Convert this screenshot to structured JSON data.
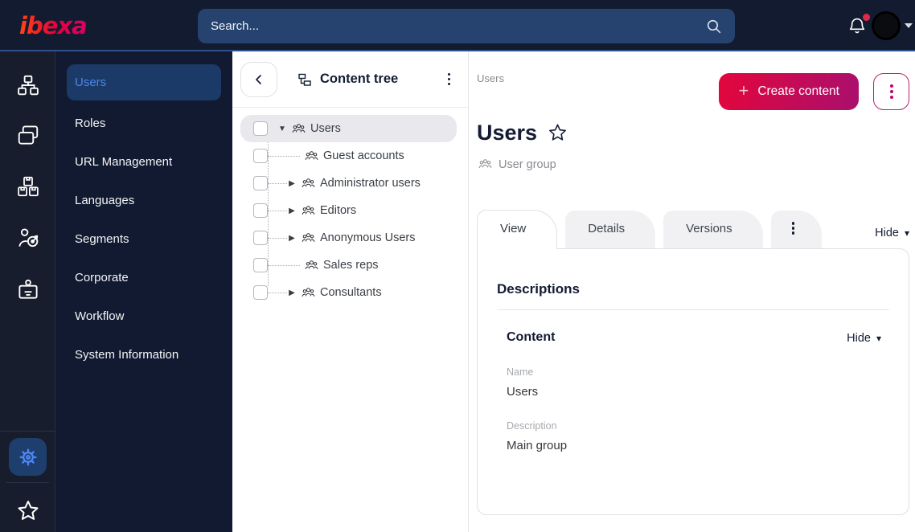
{
  "topbar": {
    "logo_text": "ibexa",
    "search_placeholder": "Search..."
  },
  "icons": {
    "tri_down": "▼",
    "tri_right": "▶",
    "caret_down": "▾",
    "plus": "+"
  },
  "sidebar": {
    "items": [
      {
        "label": "Users",
        "active": true
      },
      {
        "label": "Roles"
      },
      {
        "label": "URL Management"
      },
      {
        "label": "Languages"
      },
      {
        "label": "Segments"
      },
      {
        "label": "Corporate"
      },
      {
        "label": "Workflow"
      },
      {
        "label": "System Information"
      }
    ]
  },
  "content_tree": {
    "title": "Content tree",
    "items": [
      {
        "label": "Users",
        "expanded": true,
        "selected": true
      },
      {
        "label": "Guest accounts",
        "leaf": true
      },
      {
        "label": "Administrator users",
        "collapsed": true
      },
      {
        "label": "Editors",
        "collapsed": true
      },
      {
        "label": "Anonymous Users",
        "collapsed": true
      },
      {
        "label": "Sales reps",
        "leaf": true
      },
      {
        "label": "Consultants",
        "collapsed": true
      }
    ]
  },
  "main": {
    "breadcrumb": "Users",
    "create_button_label": "Create content",
    "title": "Users",
    "content_type_label": "User group",
    "tabs": [
      {
        "label": "View",
        "active": true
      },
      {
        "label": "Details"
      },
      {
        "label": "Versions"
      }
    ],
    "hide_label": "Hide",
    "card": {
      "section_title": "Descriptions",
      "group_title": "Content",
      "hide_label": "Hide",
      "fields": [
        {
          "label": "Name",
          "value": "Users"
        },
        {
          "label": "Description",
          "value": "Main group"
        }
      ]
    }
  },
  "colors": {
    "topbar_bg": "#131b31",
    "accent_blue": "#4e86e9",
    "brand_gradient_start": "#e3063c",
    "brand_gradient_end": "#a90f6e",
    "notification_red": "#e0294a"
  }
}
